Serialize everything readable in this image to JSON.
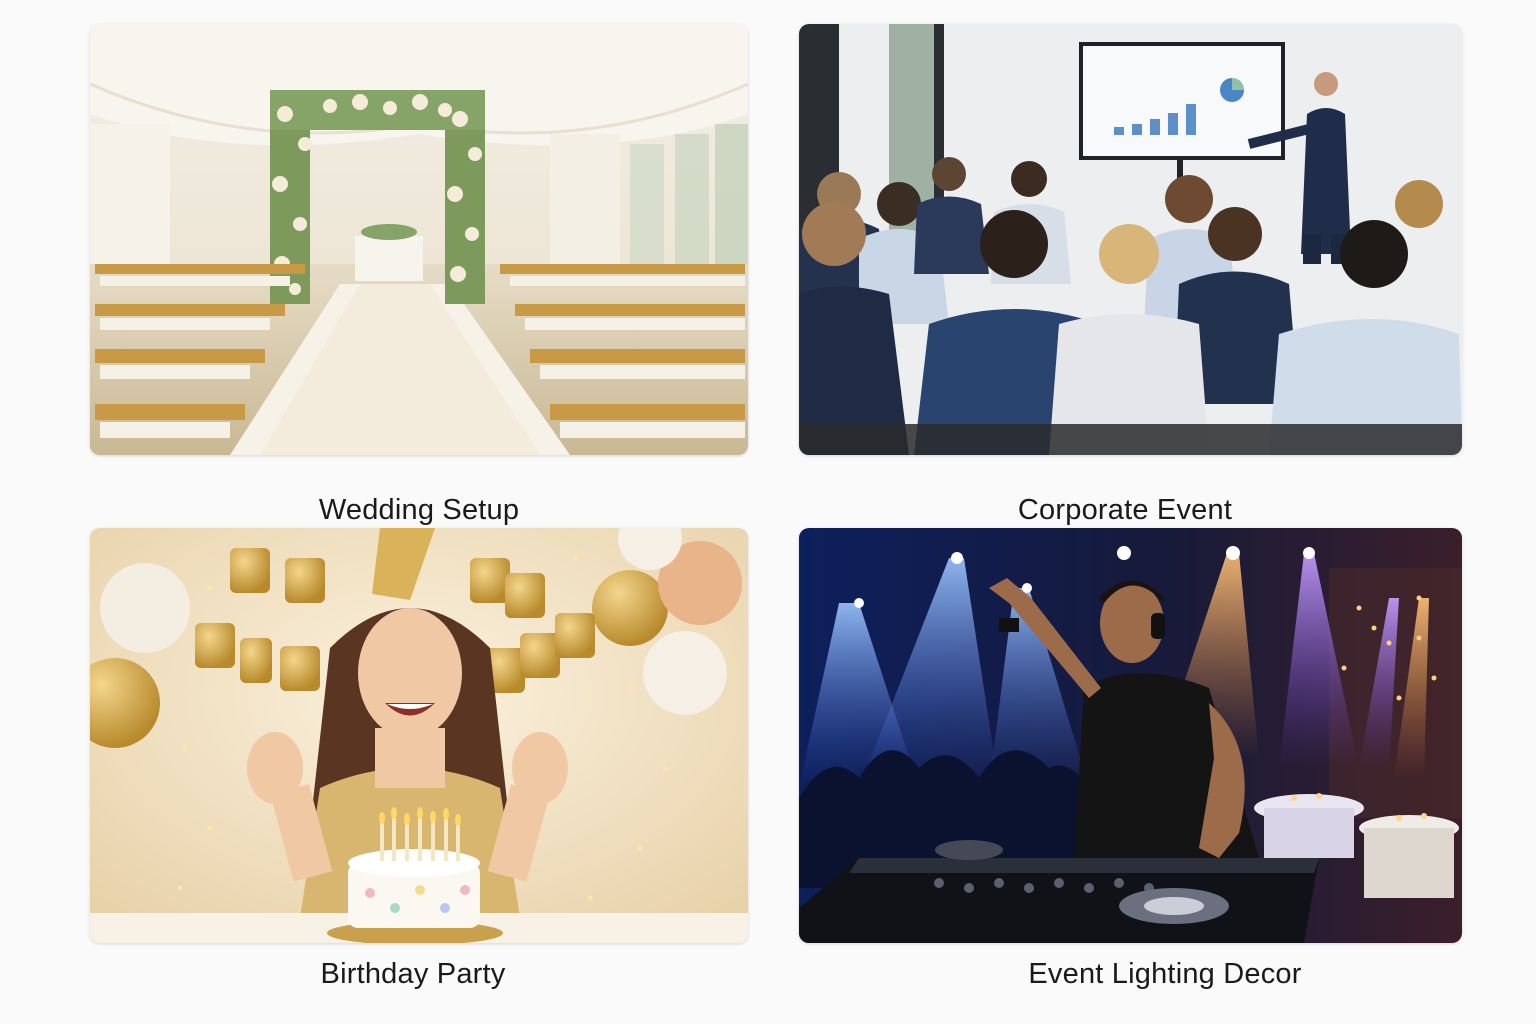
{
  "gallery": {
    "items": [
      {
        "caption": "Wedding Setup",
        "image": "wedding-ceremony-photo"
      },
      {
        "caption": "Corporate Event",
        "image": "corporate-presentation-photo"
      },
      {
        "caption": "Birthday Party",
        "image": "birthday-celebration-photo"
      },
      {
        "caption": "Event Lighting Decor",
        "image": "dj-lighting-photo"
      }
    ]
  }
}
